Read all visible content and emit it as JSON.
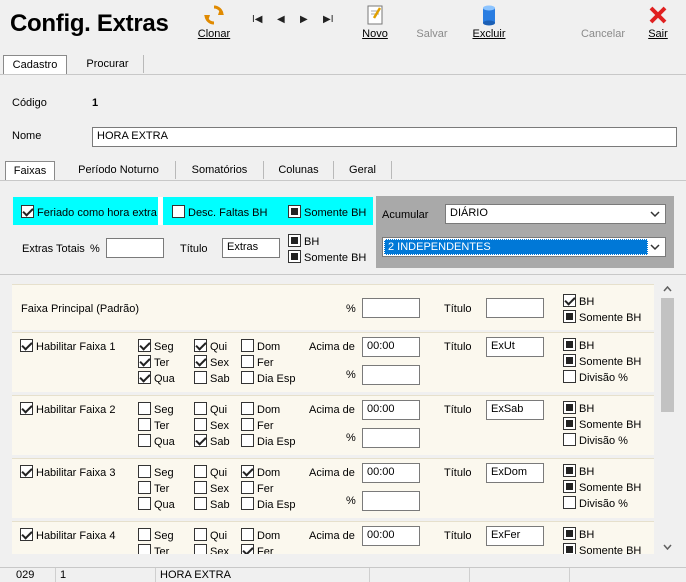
{
  "window": {
    "title": "Config. Extras"
  },
  "toolbar": {
    "clonar": "Clonar",
    "novo": "Novo",
    "salvar": "Salvar",
    "excluir": "Excluir",
    "cancelar": "Cancelar",
    "sair": "Sair",
    "nav_first": "I◀",
    "nav_prev": "◀",
    "nav_next": "▶",
    "nav_last": "▶I"
  },
  "top_tabs": [
    {
      "label": "Cadastro"
    },
    {
      "label": "Procurar"
    }
  ],
  "form": {
    "codigo_label": "Código",
    "codigo_value": "1",
    "nome_label": "Nome",
    "nome_value": "HORA EXTRA"
  },
  "sub_tabs": [
    {
      "label": "Faixas"
    },
    {
      "label": "Período Noturno"
    },
    {
      "label": "Somatórios"
    },
    {
      "label": "Colunas"
    },
    {
      "label": "Geral"
    }
  ],
  "header": {
    "feriado_label": "Feriado como hora extra",
    "desc_faltas_label": "Desc. Faltas BH",
    "somente_bh_label": "Somente BH",
    "extras_totais_label": "Extras Totais",
    "percent": "%",
    "titulo_label": "Título",
    "titulo_value": "Extras",
    "bh_label": "BH",
    "somente_bh2_label": "Somente BH",
    "acumular_label": "Acumular",
    "acumular_value": "DIÁRIO",
    "modo_value": "2 INDEPENDENTES"
  },
  "faixa_principal": {
    "label": "Faixa Principal (Padrão)",
    "percent": "%",
    "titulo_label": "Título",
    "bh_label": "BH",
    "somente_bh_label": "Somente BH"
  },
  "labels": {
    "days": [
      "Seg",
      "Ter",
      "Qua",
      "Qui",
      "Sex",
      "Sab",
      "Dom",
      "Fer",
      "Dia Esp"
    ],
    "acima_de": "Acima de",
    "percent": "%",
    "titulo": "Título",
    "bh": "BH",
    "somente_bh": "Somente BH",
    "divisao": "Divisão %"
  },
  "faixas": [
    {
      "label": "Habilitar Faixa 1",
      "acima": "00:00",
      "titulo": "ExUt",
      "days_on": [
        true,
        true,
        true,
        true,
        true,
        false,
        false,
        false,
        false
      ]
    },
    {
      "label": "Habilitar Faixa 2",
      "acima": "00:00",
      "titulo": "ExSab",
      "days_on": [
        false,
        false,
        false,
        false,
        false,
        true,
        false,
        false,
        false
      ]
    },
    {
      "label": "Habilitar Faixa 3",
      "acima": "00:00",
      "titulo": "ExDom",
      "days_on": [
        false,
        false,
        false,
        false,
        false,
        false,
        true,
        false,
        false
      ]
    },
    {
      "label": "Habilitar Faixa 4",
      "acima": "00:00",
      "titulo": "ExFer",
      "days_on": [
        false,
        false,
        false,
        false,
        false,
        false,
        false,
        true,
        false
      ]
    }
  ],
  "status": {
    "c1": "029",
    "c2": "1",
    "c3": "HORA EXTRA"
  },
  "colors": {
    "highlight": "#00ffff",
    "selection": "#0078d7",
    "panel": "#fbf8ee"
  }
}
